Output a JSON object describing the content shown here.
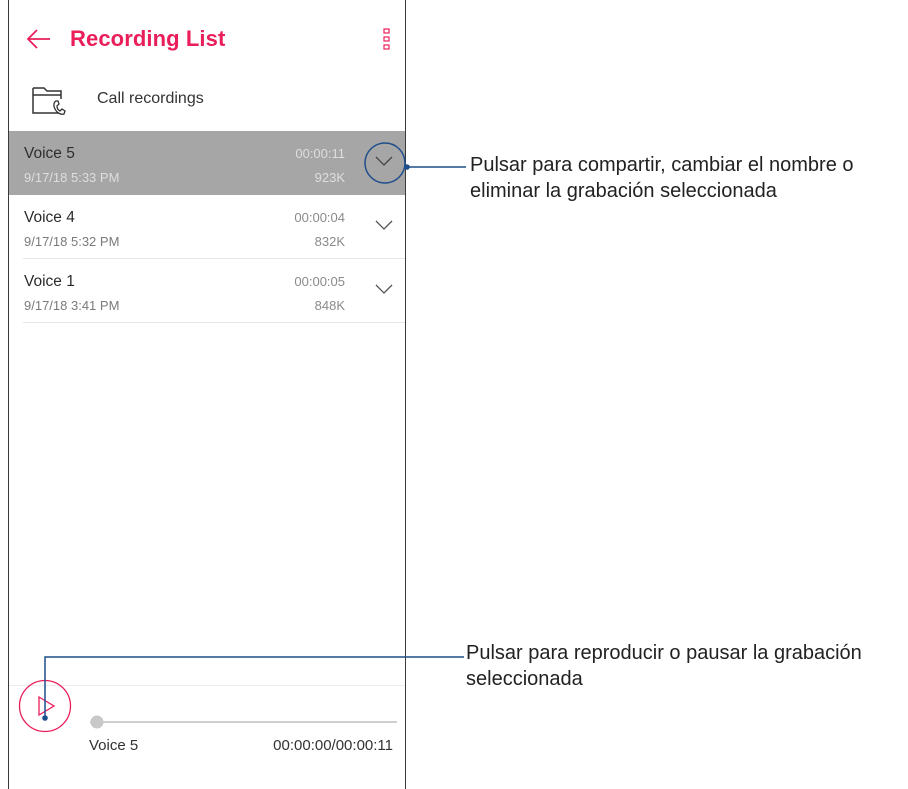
{
  "header": {
    "title": "Recording List"
  },
  "call_recordings": {
    "label": "Call recordings"
  },
  "recordings": [
    {
      "name": "Voice 5",
      "date": "9/17/18 5:33 PM",
      "duration": "00:00:11",
      "size": "923K",
      "selected": true
    },
    {
      "name": "Voice 4",
      "date": "9/17/18 5:32 PM",
      "duration": "00:00:04",
      "size": "832K",
      "selected": false
    },
    {
      "name": "Voice 1",
      "date": "9/17/18 3:41 PM",
      "duration": "00:00:05",
      "size": "848K",
      "selected": false
    }
  ],
  "player": {
    "track_name": "Voice 5",
    "time": "00:00:00/00:00:11",
    "progress": 0
  },
  "annotations": {
    "expand": "Pulsar para compartir, cambiar el nombre o eliminar la grabación seleccionada",
    "play": "Pulsar para reproducir o pausar la grabación seleccionada"
  },
  "icons": {
    "back": "arrow-left-icon",
    "more": "more-vert-icon",
    "folder": "phone-folder-icon",
    "expand": "chevron-down-icon",
    "play": "play-icon"
  },
  "colors": {
    "accent": "#e91e5a",
    "selected_row": "#a6a6a6",
    "callout": "#1f4e8c"
  }
}
